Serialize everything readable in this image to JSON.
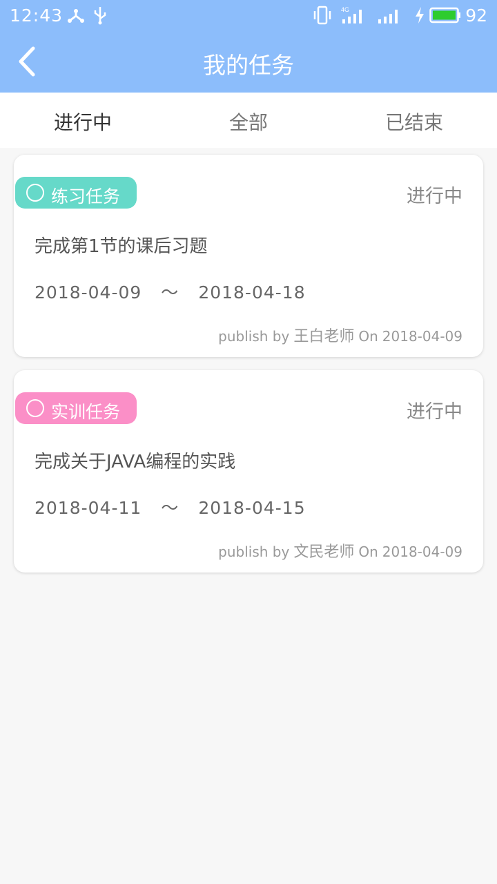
{
  "status_bar": {
    "time": "12:43",
    "battery": "92",
    "network": "4G",
    "icons": [
      "share-icon",
      "usb-icon",
      "vibrate-icon",
      "signal-4g-icon",
      "signal-icon",
      "charging-icon",
      "battery-icon"
    ]
  },
  "header": {
    "title": "我的任务",
    "back_icon": "chevron-left-icon"
  },
  "tabs": [
    {
      "label": "进行中",
      "active": true
    },
    {
      "label": "全部",
      "active": false
    },
    {
      "label": "已结束",
      "active": false
    }
  ],
  "tasks": [
    {
      "type": "练习任务",
      "type_color": "#66d9c9",
      "status": "进行中",
      "title": "完成第1节的课后习题",
      "start": "2018-04-09",
      "sep": "～",
      "end": "2018-04-18",
      "publish_prefix": "publish by",
      "author": "王白老师",
      "on": "On",
      "publish_date": "2018-04-09"
    },
    {
      "type": "实训任务",
      "type_color": "#fb8fc7",
      "status": "进行中",
      "title": "完成关于JAVA编程的实践",
      "start": "2018-04-11",
      "sep": "～",
      "end": "2018-04-15",
      "publish_prefix": "publish by",
      "author": "文民老师",
      "on": "On",
      "publish_date": "2018-04-09"
    }
  ],
  "colors": {
    "primary": "#8cbdfb",
    "background": "#f7f7f7"
  }
}
